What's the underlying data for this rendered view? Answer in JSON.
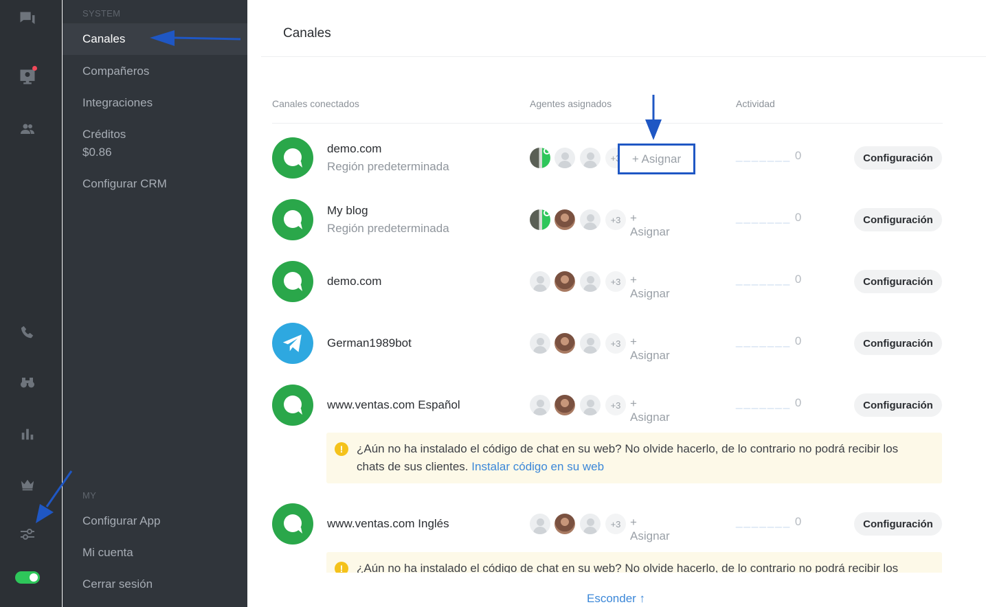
{
  "menu": {
    "section_system": "SYSTEM",
    "channels": "Canales",
    "colleagues": "Compañeros",
    "integrations": "Integraciones",
    "credits_label": "Créditos",
    "credits_value": "$0.86",
    "crm": "Configurar CRM",
    "section_my": "MY",
    "configure_app": "Configurar App",
    "my_account": "Mi cuenta",
    "logout": "Cerrar sesión"
  },
  "main": {
    "title": "Canales",
    "columns": {
      "channels": "Canales conectados",
      "agents": "Agentes asignados",
      "activity": "Actividad"
    },
    "more_label": "+3",
    "assign_label": "+ Asignar",
    "activity_dashes": "_______",
    "activity_value": "0",
    "config_label": "Configuración",
    "channels": [
      {
        "name": "demo.com",
        "sub": "Región predeterminada"
      },
      {
        "name": "My blog",
        "sub": "Región predeterminada"
      },
      {
        "name": "demo.com"
      },
      {
        "name": "German1989bot"
      },
      {
        "name": "www.ventas.com Español"
      },
      {
        "name": "www.ventas.com Inglés"
      }
    ],
    "warning_text": "¿Aún no ha instalado el código de chat en su web? No olvide hacerlo, de lo contrario no podrá recibir los chats de sus clientes.",
    "warning_link": "Instalar código en su web",
    "warning_icon": "!",
    "hide_label": "Esconder ↑"
  },
  "colors": {
    "rail_bg": "#2c3035",
    "menu_bg": "#30353b",
    "accent_green": "#2aa74a",
    "telegram_blue": "#2ea8e0",
    "link_blue": "#3b87d8",
    "annotation_blue": "#1f57c4"
  }
}
